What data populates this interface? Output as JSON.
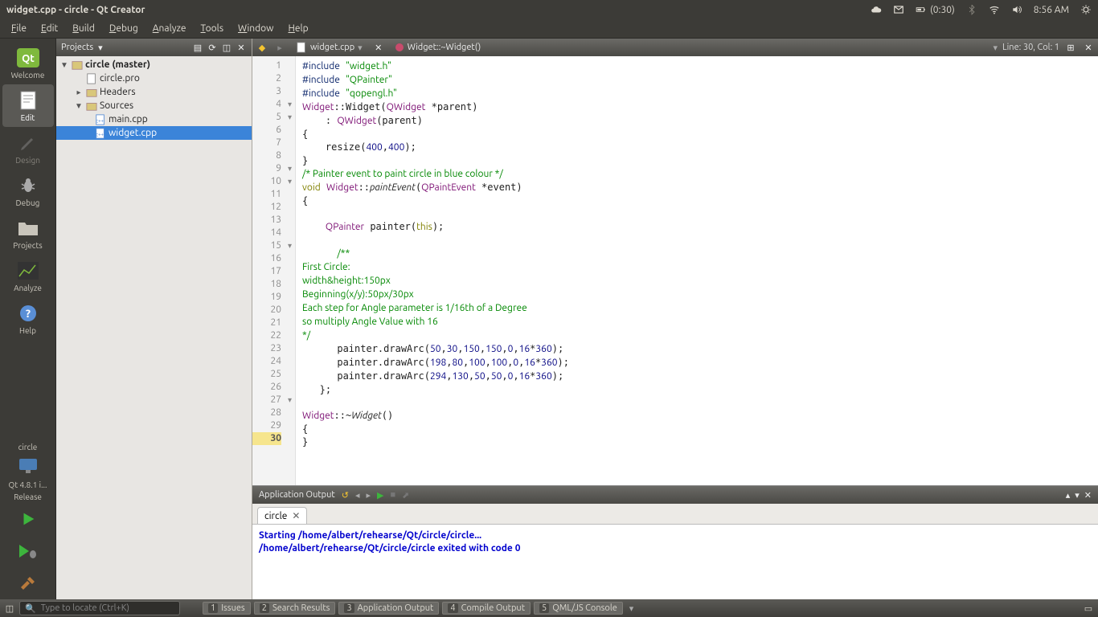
{
  "os": {
    "title": "widget.cpp - circle - Qt Creator",
    "battery": "(0:30)",
    "time": "8:56 AM"
  },
  "menu": [
    "File",
    "Edit",
    "Build",
    "Debug",
    "Analyze",
    "Tools",
    "Window",
    "Help"
  ],
  "modes": {
    "welcome": "Welcome",
    "edit": "Edit",
    "design": "Design",
    "debug": "Debug",
    "projects": "Projects",
    "analyze": "Analyze",
    "help": "Help"
  },
  "kit": {
    "project": "circle",
    "version": "Qt 4.8.1 i...",
    "build": "Release"
  },
  "projects": {
    "header": "Projects",
    "root": "circle (master)",
    "pro": "circle.pro",
    "headers": "Headers",
    "sources": "Sources",
    "main": "main.cpp",
    "widget": "widget.cpp"
  },
  "editor": {
    "file": "widget.cpp",
    "symbol": "Widget::~Widget()",
    "pos": "Line: 30, Col: 1"
  },
  "code": {
    "lines": 30
  },
  "output": {
    "title": "Application Output",
    "tab": "circle",
    "line1": "Starting /home/albert/rehearse/Qt/circle/circle...",
    "line2": "/home/albert/rehearse/Qt/circle/circle exited with code 0"
  },
  "locator": {
    "placeholder": "Type to locate (Ctrl+K)"
  },
  "bottomTabs": {
    "t1": "Issues",
    "t2": "Search Results",
    "t3": "Application Output",
    "t4": "Compile Output",
    "t5": "QML/JS Console"
  }
}
